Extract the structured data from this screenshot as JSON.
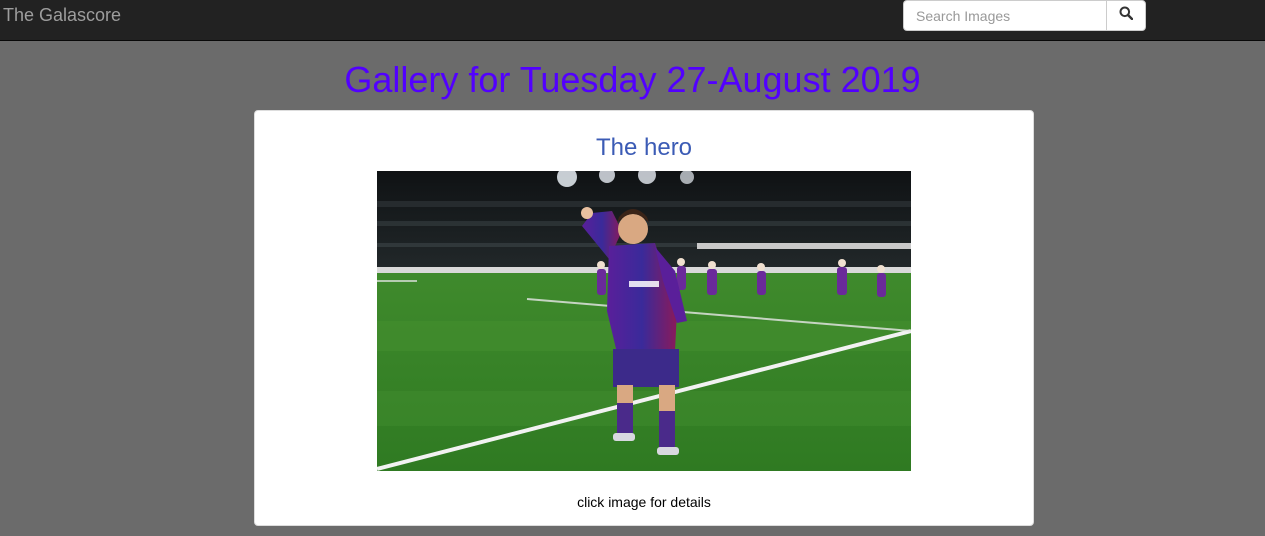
{
  "navbar": {
    "brand": "The Galascore",
    "search": {
      "placeholder": "Search Images",
      "value": ""
    },
    "search_icon": "search-icon"
  },
  "page": {
    "title": "Gallery for Tuesday 27-August 2019"
  },
  "gallery_card": {
    "title": "The hero",
    "caption": "click image for details",
    "image_alt": "Football player celebrating with raised fist in a stadium"
  },
  "colors": {
    "background": "#6b6b6b",
    "navbar": "#222222",
    "title": "#5200ff",
    "card_title": "#3b5bb5"
  }
}
